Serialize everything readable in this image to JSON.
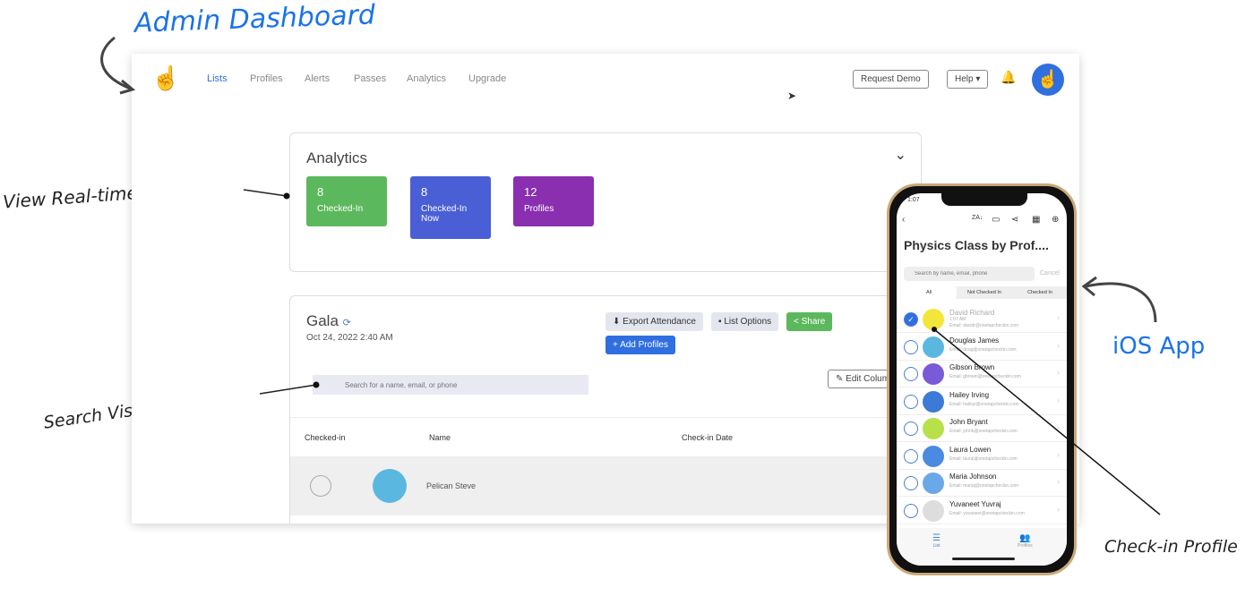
{
  "annotations": {
    "admin": "Admin Dashboard",
    "analytics": "View Real-time Analytics",
    "search": "Search Visitor Profile",
    "ios": "iOS App",
    "checkin": "Check-in Profile"
  },
  "colors": {
    "accent": "#2f6fe0",
    "green": "#5cb85c",
    "blue": "#4a5fd6",
    "purple": "#8a2fb0",
    "annot_blue": "#1a73e8"
  },
  "nav": {
    "items": [
      "Lists",
      "Profiles",
      "Alerts",
      "Passes",
      "Analytics",
      "Upgrade"
    ],
    "request_demo": "Request Demo",
    "help": "Help ▾"
  },
  "analytics": {
    "title": "Analytics",
    "stats": [
      {
        "value": "8",
        "label": "Checked-In"
      },
      {
        "value": "8",
        "label": "Checked-In Now"
      },
      {
        "value": "12",
        "label": "Profiles"
      }
    ]
  },
  "list": {
    "title": "Gala",
    "date": "Oct 24, 2022 2:40 AM",
    "export": "Export Attendance",
    "options": "▪ List Options",
    "share": "Share",
    "add": "+ Add Profiles",
    "search_placeholder": "Search for a name, email, or phone",
    "edit_columns": "Edit Colum",
    "columns": [
      "Checked-in",
      "Name",
      "Check-in Date"
    ],
    "rows": [
      {
        "name": "Pelican Steve"
      }
    ]
  },
  "phone": {
    "time": "1:07",
    "title": "Physics Class by Prof....",
    "search_placeholder": "Search by name, email, phone",
    "cancel": "Cancel",
    "segments": [
      "All",
      "Not Checked In",
      "Checked In"
    ],
    "people": [
      {
        "name": "David Richard",
        "time": "1:07 AM",
        "email": "Email: davidr@onetapcheckin.com",
        "checked": true,
        "color": "#f2e63a"
      },
      {
        "name": "Douglas James",
        "email": "Email: doug@onetapcheckin.com",
        "color": "#5ab8e0"
      },
      {
        "name": "Gibson Brown",
        "email": "Email: gbrown@onetapcheckin.com",
        "color": "#7a5ad6"
      },
      {
        "name": "Hailey Irving",
        "email": "Email: haileyi@onetapcheckin.com",
        "color": "#3b7ad6"
      },
      {
        "name": "John Bryant",
        "email": "Email: johnb@onetapcheckin.com",
        "color": "#b8e04a"
      },
      {
        "name": "Laura Lowen",
        "email": "Email: laural@onetapcheckin.com",
        "color": "#4a8ae0"
      },
      {
        "name": "Maria Johnson",
        "email": "Email: mariaj@onetapcheckin.com",
        "color": "#6aa8e8"
      },
      {
        "name": "Yuvaneet Yuvraj",
        "email": "Email: yuvaneet@onetapcheckin.com",
        "color": "#ddd"
      }
    ],
    "tabs": [
      "List",
      "Profiles"
    ]
  }
}
